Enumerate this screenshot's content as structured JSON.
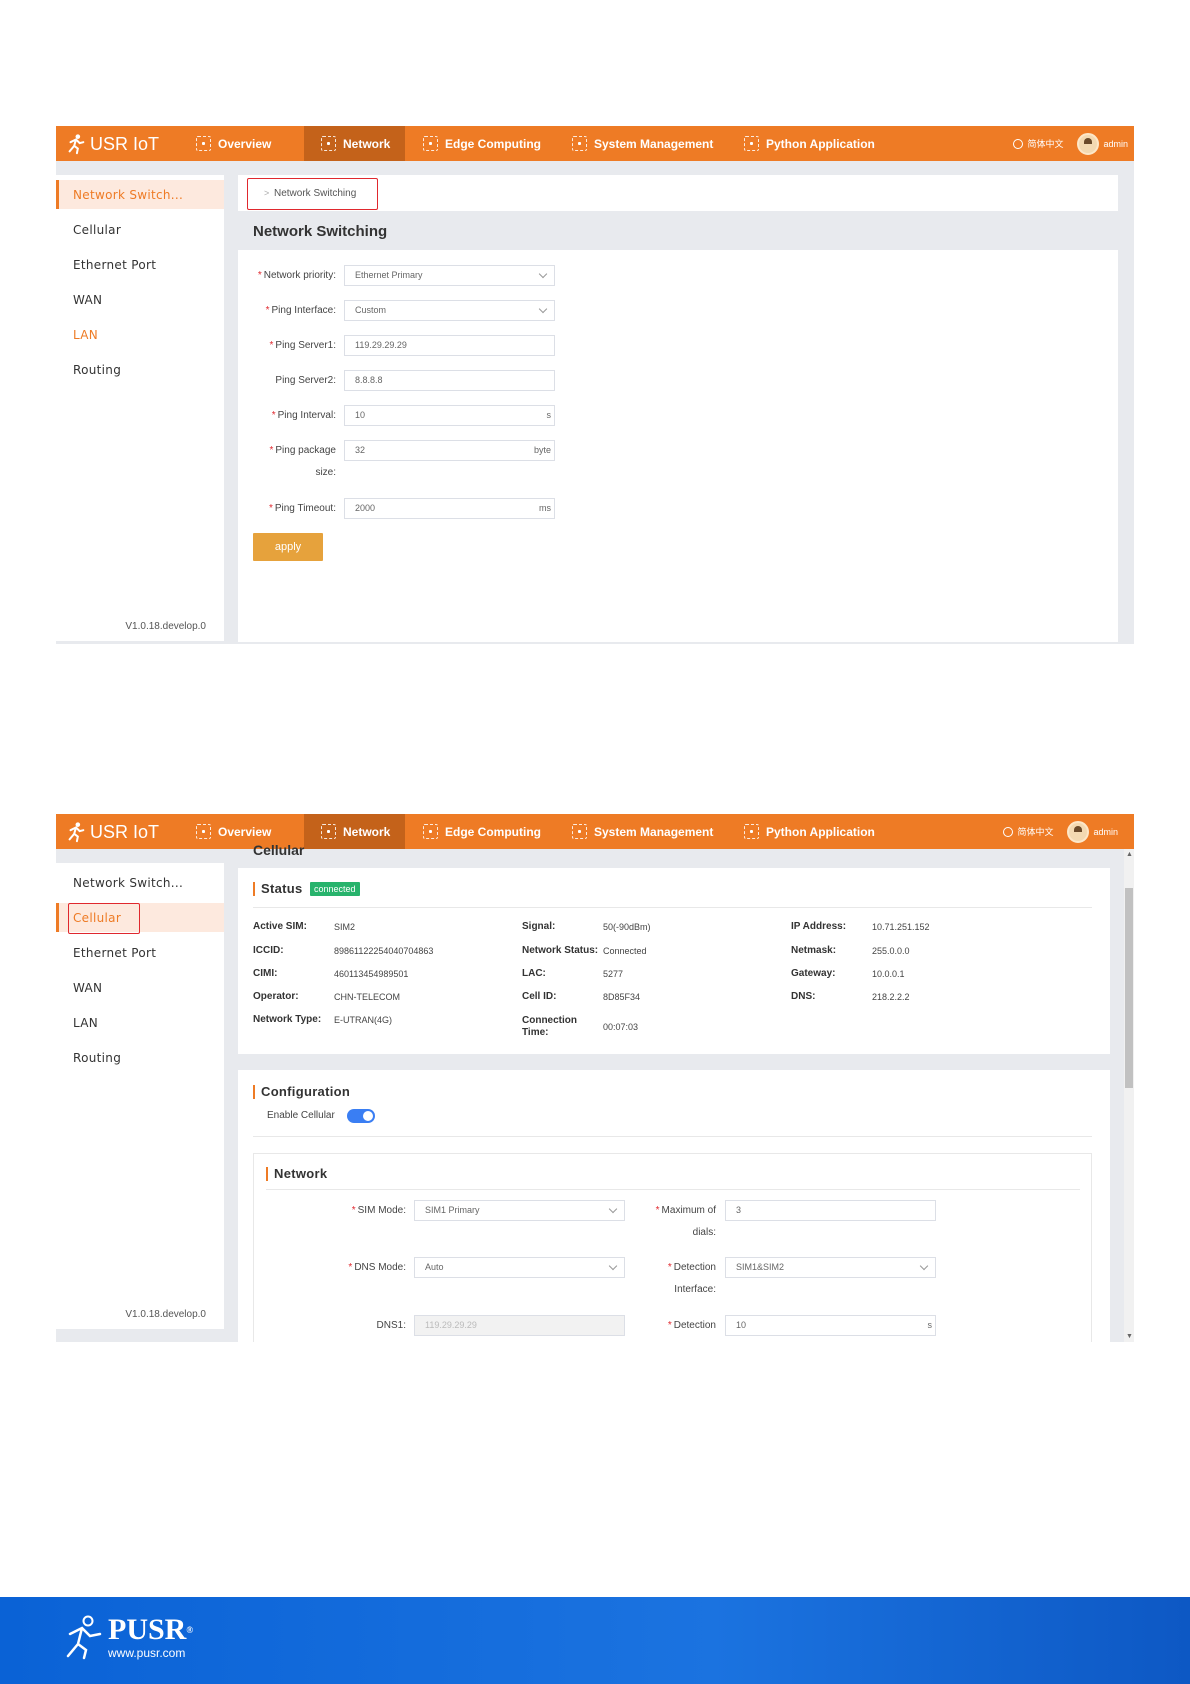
{
  "topbar": {
    "brand": "USR IoT",
    "nav": [
      "Overview",
      "Network",
      "Edge Computing",
      "System Management",
      "Python Application"
    ],
    "language": "简体中文",
    "user": "admin"
  },
  "sidebar": {
    "items": [
      "Network Switch...",
      "Cellular",
      "Ethernet Port",
      "WAN",
      "LAN",
      "Routing"
    ],
    "version": "V1.0.18.develop.0"
  },
  "screen1": {
    "breadcrumb": "Network Switching",
    "page_title": "Network Switching",
    "fields": {
      "network_priority": {
        "label": "Network priority:",
        "value": "Ethernet Primary"
      },
      "ping_interface": {
        "label": "Ping Interface:",
        "value": "Custom"
      },
      "ping_server1": {
        "label": "Ping Server1:",
        "value": "119.29.29.29"
      },
      "ping_server2": {
        "label": "Ping Server2:",
        "value": "8.8.8.8"
      },
      "ping_interval": {
        "label": "Ping Interval:",
        "value": "10",
        "unit": "s"
      },
      "ping_package_size": {
        "label_line1": "Ping package",
        "label_line2": "size:",
        "value": "32",
        "unit": "byte"
      },
      "ping_timeout": {
        "label": "Ping Timeout:",
        "value": "2000",
        "unit": "ms"
      }
    },
    "apply_label": "apply"
  },
  "screen2": {
    "page_title_clipped": "Cellular",
    "status": {
      "title": "Status",
      "badge": "connected",
      "col1": [
        {
          "label": "Active SIM:",
          "value": "SIM2"
        },
        {
          "label": "ICCID:",
          "value": "89861122254040704863"
        },
        {
          "label": "CIMI:",
          "value": "460113454989501"
        },
        {
          "label": "Operator:",
          "value": "CHN-TELECOM"
        },
        {
          "label": "Network Type:",
          "value": "E-UTRAN(4G)"
        }
      ],
      "col2": [
        {
          "label": "Signal:",
          "value": "50(-90dBm)"
        },
        {
          "label": "Network Status:",
          "value": "Connected"
        },
        {
          "label": "LAC:",
          "value": "5277"
        },
        {
          "label": "Cell ID:",
          "value": "8D85F34"
        },
        {
          "label_line1": "Connection",
          "label_line2": "Time:",
          "value": "00:07:03"
        }
      ],
      "col3": [
        {
          "label": "IP Address:",
          "value": "10.71.251.152"
        },
        {
          "label": "Netmask:",
          "value": "255.0.0.0"
        },
        {
          "label": "Gateway:",
          "value": "10.0.0.1"
        },
        {
          "label": "DNS:",
          "value": "218.2.2.2"
        }
      ]
    },
    "configuration": {
      "title": "Configuration",
      "enable_label": "Enable Cellular",
      "enabled": true,
      "network_title": "Network",
      "sim_mode": {
        "label": "SIM Mode:",
        "value": "SIM1 Primary"
      },
      "max_dials": {
        "label_line1": "Maximum of",
        "label_line2": "dials:",
        "value": "3"
      },
      "dns_mode": {
        "label": "DNS Mode:",
        "value": "Auto"
      },
      "detection_interface": {
        "label_line1": "Detection",
        "label_line2": "Interface:",
        "value": "SIM1&SIM2"
      },
      "dns1": {
        "label": "DNS1:",
        "placeholder": "119.29.29.29"
      },
      "detection": {
        "label": "Detection",
        "value": "10",
        "unit": "s"
      }
    }
  },
  "footer": {
    "brand": "PUSR",
    "reg": "®",
    "url": "www.pusr.com"
  },
  "colors": {
    "accent": "#ee7b25",
    "active_nav": "#c4621a",
    "apply_button": "#e6a23c",
    "badge": "#27b36c",
    "toggle": "#3a7ef3",
    "highlight_box": "#e0282e",
    "footer": "#1b73e0"
  }
}
